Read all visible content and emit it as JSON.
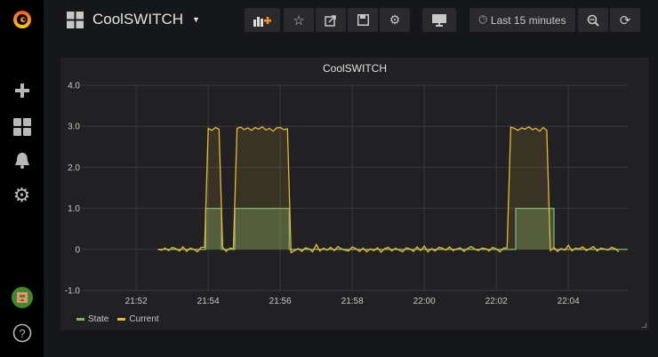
{
  "header": {
    "title": "CoolSWITCH",
    "time_range": "Last 15 minutes"
  },
  "panel": {
    "title": "CoolSWITCH"
  },
  "colors": {
    "state": "#7eb26d",
    "current": "#eab839"
  },
  "chart_data": {
    "type": "line",
    "title": "CoolSWITCH",
    "x_unit": "minutes after 21:00",
    "xlim": [
      50.49,
      65.65
    ],
    "ylim": [
      -1,
      4
    ],
    "y_ticks": [
      "4.0",
      "3.0",
      "2.0",
      "1.0",
      "0",
      "-1.0"
    ],
    "y_tick_values": [
      4,
      3,
      2,
      1,
      0,
      -1
    ],
    "x_ticks": [
      "21:52",
      "21:54",
      "21:56",
      "21:58",
      "22:00",
      "22:02",
      "22:04"
    ],
    "x_tick_values": [
      52,
      54,
      56,
      58,
      60,
      62,
      64
    ],
    "grid": true,
    "legend": "bottom-left",
    "series": [
      {
        "name": "State",
        "x": [
          52.6,
          53.93,
          53.93,
          54.37,
          54.37,
          54.74,
          54.74,
          56.25,
          56.25,
          62.54,
          62.54,
          63.6,
          63.6,
          65.65
        ],
        "values": [
          0,
          0,
          1,
          1,
          0,
          0,
          1,
          1,
          0,
          0,
          1,
          1,
          0,
          0
        ]
      },
      {
        "name": "Current",
        "x_start": 52.6,
        "x_step": 0.1,
        "values": [
          0,
          -0.02,
          0.03,
          -0.03,
          0.05,
          0.02,
          -0.04,
          0.06,
          -0.05,
          0.03,
          0,
          -0.06,
          0.05,
          0.05,
          2.95,
          2.9,
          2.97,
          2.93,
          0.05,
          -0.05,
          0.03,
          0.02,
          2.95,
          2.98,
          2.92,
          2.96,
          2.9,
          2.97,
          2.93,
          2.99,
          2.91,
          2.95,
          2.88,
          2.96,
          2.97,
          2.92,
          2.94,
          -0.08,
          -0.03,
          0.02,
          -0.05,
          0.04,
          0.01,
          -0.06,
          0.12,
          -0.04,
          0.03,
          -0.02,
          0.05,
          -0.03,
          0.07,
          0.01,
          -0.02,
          -0.04,
          0.06,
          0.02,
          -0.05,
          0.03,
          -0.06,
          0.01,
          -0.03,
          0.04,
          -0.07,
          0.02,
          0.05,
          -0.04,
          0.03,
          -0.02,
          -0.06,
          0.04,
          0.01,
          -0.05,
          0.06,
          -0.03,
          0.08,
          -0.06,
          0.02,
          -0.04,
          0.05,
          0.03,
          -0.02,
          0.06,
          -0.03,
          0.01,
          0.04,
          -0.05,
          0.02,
          0.07,
          0.01,
          -0.03,
          0.03,
          0.02,
          -0.04,
          0.05,
          0.01,
          -0.06,
          0.03,
          0.04,
          2.98,
          2.95,
          2.9,
          2.96,
          2.93,
          2.99,
          2.92,
          2.95,
          2.88,
          2.97,
          2.9,
          -0.03,
          0.04,
          -0.05,
          0.02,
          -0.02,
          0.1,
          -0.04,
          0.03,
          0.01,
          0.06,
          -0.03,
          0.02,
          0.07,
          -0.04,
          0.03,
          0.01,
          -0.02,
          0.05,
          0.02,
          -0.06
        ]
      }
    ]
  },
  "legend": {
    "state": "State",
    "current": "Current"
  }
}
